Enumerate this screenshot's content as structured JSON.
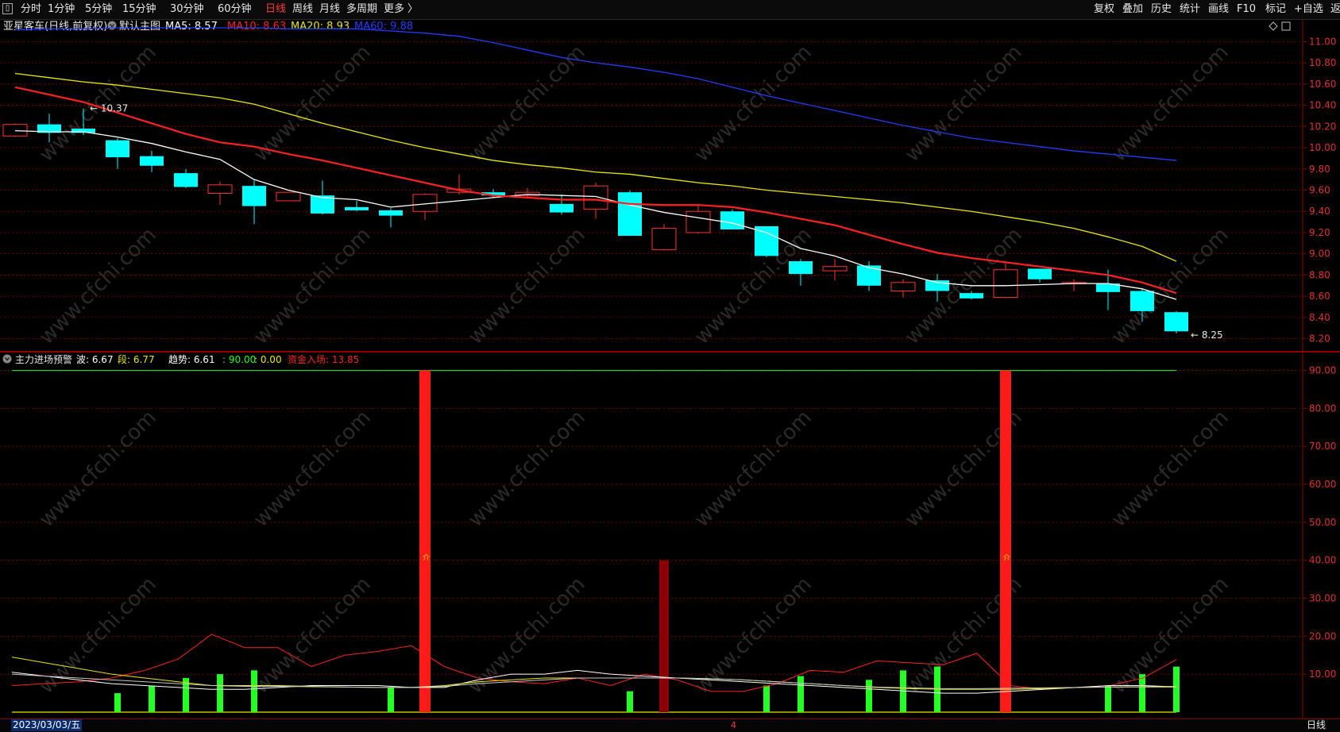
{
  "toolbar": {
    "left": [
      {
        "label": "分时"
      },
      {
        "label": "1分钟"
      },
      {
        "label": "5分钟"
      },
      {
        "label": "15分钟"
      },
      {
        "label": "30分钟"
      },
      {
        "label": "60分钟"
      },
      {
        "label": "日线",
        "active": true
      },
      {
        "label": "周线"
      },
      {
        "label": "月线"
      },
      {
        "label": "多周期"
      },
      {
        "label": "更多 〉"
      }
    ],
    "right": [
      {
        "label": "复权"
      },
      {
        "label": "叠加"
      },
      {
        "label": "历史"
      },
      {
        "label": "统计"
      },
      {
        "label": "画线"
      },
      {
        "label": "F10"
      },
      {
        "label": "标记"
      },
      {
        "label": "+自选"
      },
      {
        "label": "返回"
      }
    ]
  },
  "main_panel": {
    "stock_title": "亚星客车(日线,前复权)",
    "template_label": "默认主图",
    "indicators": [
      {
        "label": "MA5: 8.57",
        "color": "#ffffff"
      },
      {
        "label": "MA10: 8.63",
        "color": "#ff2020"
      },
      {
        "label": "MA20: 8.93",
        "color": "#e8e800"
      },
      {
        "label": "MA60: 9.88",
        "color": "#1f3cff"
      }
    ],
    "high_marker": "10.37",
    "low_marker": "8.25"
  },
  "sub_panel": {
    "indicator_name": "主力进场预警",
    "values": [
      {
        "label": "波: 6.67",
        "color": "#ffffff"
      },
      {
        "label": "段: 6.77",
        "color": "#e8e800"
      },
      {
        "label": "趋势: 6.61",
        "color": "#ffffff"
      },
      {
        "label": ": 90.00",
        "color": "#22ff22"
      },
      {
        "label": ": 0.00",
        "color": "#e8e800"
      },
      {
        "label": "资金入场: 13.85",
        "color": "#ff2020"
      }
    ],
    "signal_text": "介"
  },
  "status": {
    "date": "2023/03/03/五",
    "period": "日线",
    "tick": "4"
  },
  "watermark": "www.cfchi.com",
  "colors": {
    "up": "#ff3030",
    "down": "#00ffff",
    "grid": "#8b0000"
  },
  "chart_data": [
    {
      "type": "candlestick",
      "ylim": [
        8.1,
        11.1
      ],
      "y_ticks": [
        "11.00",
        "10.80",
        "10.60",
        "10.40",
        "10.20",
        "10.00",
        "9.80",
        "9.60",
        "9.40",
        "9.20",
        "9.00",
        "8.80",
        "8.60",
        "8.40",
        "8.20"
      ],
      "candles": [
        {
          "o": 10.11,
          "h": 10.23,
          "l": 10.1,
          "c": 10.22
        },
        {
          "o": 10.22,
          "h": 10.32,
          "l": 10.05,
          "c": 10.14
        },
        {
          "o": 10.18,
          "h": 10.37,
          "l": 10.12,
          "c": 10.14
        },
        {
          "o": 10.07,
          "h": 10.09,
          "l": 9.8,
          "c": 9.91
        },
        {
          "o": 9.92,
          "h": 9.97,
          "l": 9.77,
          "c": 9.83
        },
        {
          "o": 9.76,
          "h": 9.8,
          "l": 9.62,
          "c": 9.63
        },
        {
          "o": 9.57,
          "h": 9.68,
          "l": 9.46,
          "c": 9.65
        },
        {
          "o": 9.64,
          "h": 9.7,
          "l": 9.28,
          "c": 9.45
        },
        {
          "o": 9.5,
          "h": 9.58,
          "l": 9.5,
          "c": 9.58
        },
        {
          "o": 9.55,
          "h": 9.69,
          "l": 9.37,
          "c": 9.38
        },
        {
          "o": 9.44,
          "h": 9.5,
          "l": 9.4,
          "c": 9.41
        },
        {
          "o": 9.41,
          "h": 9.43,
          "l": 9.25,
          "c": 9.36
        },
        {
          "o": 9.4,
          "h": 9.57,
          "l": 9.32,
          "c": 9.56
        },
        {
          "o": 9.58,
          "h": 9.75,
          "l": 9.56,
          "c": 9.61
        },
        {
          "o": 9.58,
          "h": 9.61,
          "l": 9.53,
          "c": 9.55
        },
        {
          "o": 9.55,
          "h": 9.62,
          "l": 9.52,
          "c": 9.58
        },
        {
          "o": 9.47,
          "h": 9.56,
          "l": 9.37,
          "c": 9.39
        },
        {
          "o": 9.42,
          "h": 9.67,
          "l": 9.33,
          "c": 9.64
        },
        {
          "o": 9.58,
          "h": 9.6,
          "l": 9.17,
          "c": 9.17
        },
        {
          "o": 9.04,
          "h": 9.28,
          "l": 9.03,
          "c": 9.24
        },
        {
          "o": 9.2,
          "h": 9.45,
          "l": 9.19,
          "c": 9.4
        },
        {
          "o": 9.4,
          "h": 9.42,
          "l": 9.24,
          "c": 9.23
        },
        {
          "o": 9.26,
          "h": 9.26,
          "l": 8.97,
          "c": 8.98
        },
        {
          "o": 8.93,
          "h": 8.95,
          "l": 8.7,
          "c": 8.81
        },
        {
          "o": 8.84,
          "h": 8.95,
          "l": 8.75,
          "c": 8.88
        },
        {
          "o": 8.89,
          "h": 8.93,
          "l": 8.65,
          "c": 8.7
        },
        {
          "o": 8.65,
          "h": 8.76,
          "l": 8.59,
          "c": 8.73
        },
        {
          "o": 8.75,
          "h": 8.81,
          "l": 8.55,
          "c": 8.65
        },
        {
          "o": 8.63,
          "h": 8.65,
          "l": 8.57,
          "c": 8.58
        },
        {
          "o": 8.59,
          "h": 8.92,
          "l": 8.58,
          "c": 8.85
        },
        {
          "o": 8.86,
          "h": 8.86,
          "l": 8.73,
          "c": 8.76
        },
        {
          "o": 8.73,
          "h": 8.76,
          "l": 8.65,
          "c": 8.73
        },
        {
          "o": 8.72,
          "h": 8.85,
          "l": 8.47,
          "c": 8.64
        },
        {
          "o": 8.65,
          "h": 8.67,
          "l": 8.36,
          "c": 8.46
        },
        {
          "o": 8.45,
          "h": 8.46,
          "l": 8.25,
          "c": 8.27
        }
      ],
      "series": [
        {
          "name": "MA5",
          "color": "#ffffff",
          "values": [
            10.16,
            10.15,
            10.15,
            10.1,
            10.04,
            9.96,
            9.89,
            9.7,
            9.6,
            9.53,
            9.51,
            9.44,
            9.47,
            9.5,
            9.53,
            9.56,
            9.55,
            9.54,
            9.46,
            9.39,
            9.34,
            9.29,
            9.2,
            9.05,
            8.98,
            8.87,
            8.81,
            8.73,
            8.7,
            8.7,
            8.71,
            8.72,
            8.72,
            8.67,
            8.57
          ]
        },
        {
          "name": "MA10",
          "color": "#ff2020",
          "values": [
            10.57,
            10.5,
            10.43,
            10.33,
            10.23,
            10.13,
            10.05,
            10.01,
            9.94,
            9.88,
            9.81,
            9.74,
            9.67,
            9.6,
            9.55,
            9.53,
            9.51,
            9.51,
            9.47,
            9.46,
            9.46,
            9.44,
            9.39,
            9.33,
            9.27,
            9.18,
            9.09,
            9.01,
            8.96,
            8.92,
            8.88,
            8.84,
            8.8,
            8.73,
            8.63
          ]
        },
        {
          "name": "MA20",
          "color": "#e8e800",
          "values": [
            10.73,
            10.7,
            10.66,
            10.62,
            10.59,
            10.55,
            10.51,
            10.47,
            10.41,
            10.32,
            10.23,
            10.15,
            10.07,
            10.0,
            9.94,
            9.88,
            9.84,
            9.81,
            9.77,
            9.75,
            9.71,
            9.67,
            9.64,
            9.6,
            9.57,
            9.54,
            9.51,
            9.48,
            9.44,
            9.4,
            9.35,
            9.3,
            9.24,
            9.16,
            9.07,
            8.93
          ]
        },
        {
          "name": "MA60",
          "color": "#1f3cff",
          "values": [
            11.1,
            11.11,
            11.12,
            11.12,
            11.13,
            11.13,
            11.13,
            11.13,
            11.13,
            11.12,
            11.12,
            11.12,
            11.1,
            11.08,
            11.05,
            10.99,
            10.92,
            10.85,
            10.8,
            10.76,
            10.71,
            10.65,
            10.57,
            10.49,
            10.42,
            10.35,
            10.28,
            10.21,
            10.15,
            10.09,
            10.05,
            10.01,
            9.97,
            9.94,
            9.91,
            9.88
          ]
        }
      ]
    },
    {
      "type": "bar",
      "ylim": [
        0,
        92
      ],
      "y_ticks": [
        "90.00",
        "80.00",
        "70.00",
        "60.00",
        "50.00",
        "40.00",
        "30.00",
        "20.00",
        "10.00"
      ],
      "bars_green": [
        0,
        0,
        0,
        5,
        7,
        9,
        10,
        11,
        0,
        0,
        0,
        6.5,
        0,
        0,
        0,
        0,
        0,
        0,
        5.5,
        9,
        0,
        0,
        7,
        9.5,
        0,
        8.5,
        11,
        12,
        0,
        0,
        0,
        0,
        7,
        10,
        12
      ],
      "bars_red": [
        0,
        0,
        0,
        0,
        0,
        0,
        0,
        0,
        0,
        0,
        0,
        0,
        90,
        0,
        0,
        0,
        0,
        0,
        0,
        0,
        0,
        0,
        0,
        0,
        0,
        0,
        0,
        0,
        0,
        90,
        0,
        0,
        0,
        0,
        0
      ],
      "bars_darkred": [
        0,
        0,
        0,
        0,
        0,
        0,
        0,
        0,
        0,
        0,
        0,
        0,
        0,
        0,
        0,
        0,
        0,
        0,
        0,
        40,
        0,
        0,
        0,
        0,
        0,
        0,
        0,
        0,
        0,
        0,
        0,
        0,
        0,
        0,
        0
      ],
      "series": [
        {
          "name": "资金入场",
          "color": "#ff2020",
          "values": [
            7,
            7.5,
            8,
            9,
            11,
            14,
            20.5,
            17,
            17,
            12,
            15,
            16,
            17.5,
            12,
            9,
            8,
            7.5,
            9,
            7,
            10,
            8.5,
            5.5,
            5.5,
            7.5,
            11,
            10.5,
            13.5,
            13,
            12.5,
            15.5,
            7,
            6,
            6.5,
            7,
            9,
            13.85
          ]
        },
        {
          "name": "波",
          "color": "#ffffff",
          "values": [
            10.5,
            9.5,
            8.5,
            7.5,
            7,
            6.5,
            6,
            6,
            6.5,
            7,
            7,
            7,
            6.5,
            6.5,
            8.5,
            10,
            10,
            11,
            10,
            9.5,
            9,
            8.5,
            8,
            7.5,
            7,
            6.5,
            6,
            5.5,
            5,
            5,
            5.5,
            6,
            6.5,
            7,
            7,
            6.67
          ]
        },
        {
          "name": "段",
          "color": "#e8e800",
          "values": [
            14.5,
            13,
            11.5,
            10,
            9,
            8,
            7,
            7,
            7,
            6.8,
            6.6,
            6.5,
            6.5,
            7,
            8,
            8.5,
            9,
            9,
            9,
            9,
            9,
            8.8,
            8.5,
            8,
            7.5,
            7,
            6.5,
            6.2,
            6,
            6,
            6,
            6.2,
            6.5,
            6.6,
            6.7,
            6.77
          ]
        },
        {
          "name": "趋势",
          "color": "#c8c8c8",
          "values": [
            10,
            9.5,
            9,
            8.5,
            8,
            7.5,
            7,
            6.8,
            6.8,
            6.7,
            6.6,
            6.5,
            6.5,
            6.8,
            7.5,
            8,
            8.5,
            9,
            9,
            9,
            9,
            8.8,
            8.5,
            8,
            7.5,
            7,
            6.6,
            6.4,
            6.2,
            6.2,
            6.3,
            6.4,
            6.5,
            6.6,
            6.6,
            6.61
          ]
        },
        {
          "name": "90.00",
          "color": "#22ff22",
          "values": [
            90
          ]
        },
        {
          "name": "0.00",
          "color": "#e8e800",
          "values": [
            0
          ]
        }
      ]
    }
  ]
}
